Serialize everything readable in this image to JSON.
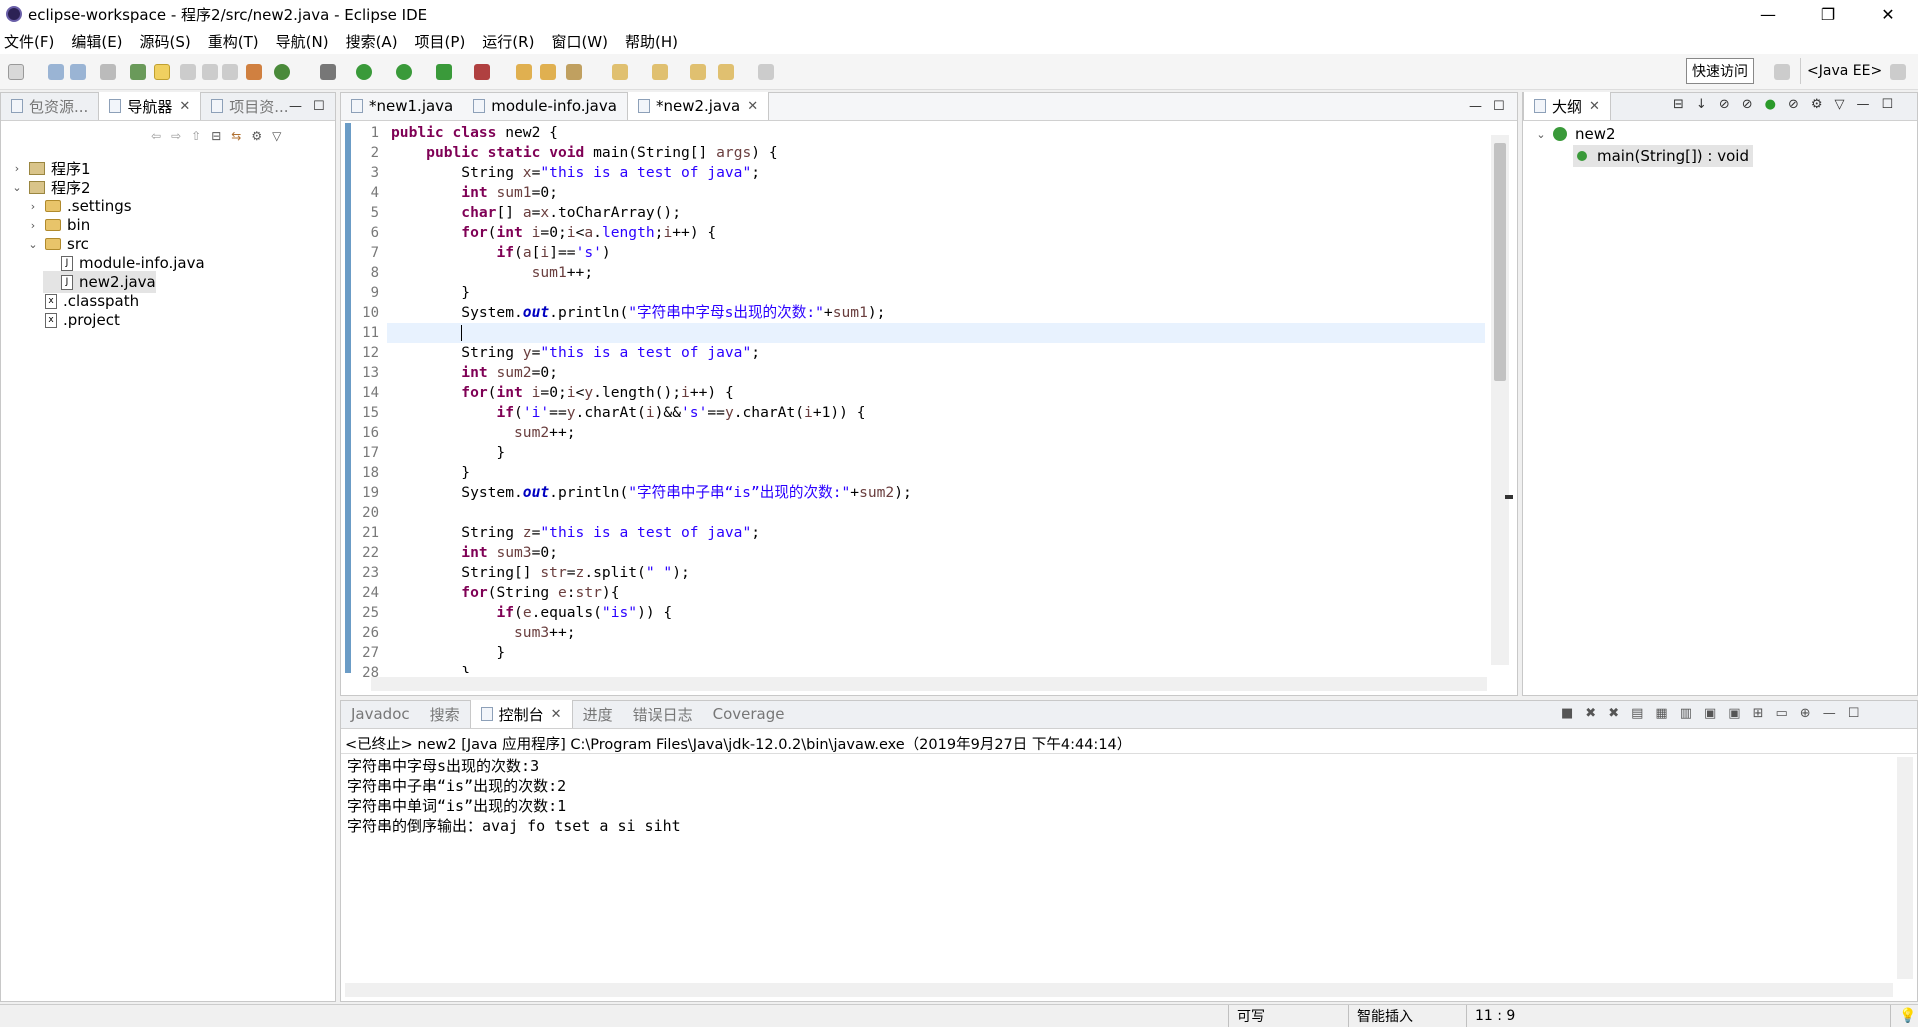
{
  "window": {
    "title": "eclipse-workspace - 程序2/src/new2.java - Eclipse IDE",
    "minimize": "—",
    "restore": "❐",
    "close": "✕"
  },
  "menu": [
    "文件(F)",
    "编辑(E)",
    "源码(S)",
    "重构(T)",
    "导航(N)",
    "搜索(A)",
    "项目(P)",
    "运行(R)",
    "窗口(W)",
    "帮助(H)"
  ],
  "toolbar": {
    "quick_access": "快速访问",
    "perspective": "<Java EE>"
  },
  "left_panel": {
    "tabs": [
      "包资源...",
      "导航器",
      "项目资..."
    ],
    "active_tab": 1,
    "tree": [
      {
        "label": "程序1",
        "type": "project",
        "level": 0,
        "arrow": "›"
      },
      {
        "label": "程序2",
        "type": "project",
        "level": 0,
        "arrow": "⌄"
      },
      {
        "label": ".settings",
        "type": "folder",
        "level": 1,
        "arrow": "›"
      },
      {
        "label": "bin",
        "type": "folder",
        "level": 1,
        "arrow": "›"
      },
      {
        "label": "src",
        "type": "folder",
        "level": 1,
        "arrow": "⌄"
      },
      {
        "label": "module-info.java",
        "type": "file",
        "level": 2,
        "arrow": ""
      },
      {
        "label": "new2.java",
        "type": "file",
        "level": 2,
        "arrow": "",
        "selected": true
      },
      {
        "label": ".classpath",
        "type": "xfile",
        "level": 1,
        "arrow": ""
      },
      {
        "label": ".project",
        "type": "xfile",
        "level": 1,
        "arrow": ""
      }
    ]
  },
  "editor": {
    "tabs": [
      "*new1.java",
      "module-info.java",
      "*new2.java"
    ],
    "active_tab": 2,
    "current_line": 11,
    "lines": [
      [
        [
          "kw",
          "public "
        ],
        [
          "kw",
          "class "
        ],
        [
          "t",
          "new2 {"
        ]
      ],
      [
        [
          "t",
          "    "
        ],
        [
          "kw",
          "public "
        ],
        [
          "kw",
          "static "
        ],
        [
          "kw",
          "void "
        ],
        [
          "t",
          "main(String[] "
        ],
        [
          "var",
          "args"
        ],
        [
          "t",
          ") {"
        ]
      ],
      [
        [
          "t",
          "        String "
        ],
        [
          "var",
          "x"
        ],
        [
          "t",
          "="
        ],
        [
          "str",
          "\"this is a test of java\""
        ],
        [
          "t",
          ";"
        ]
      ],
      [
        [
          "t",
          "        "
        ],
        [
          "kw",
          "int "
        ],
        [
          "var",
          "sum1"
        ],
        [
          "t",
          "=0;"
        ]
      ],
      [
        [
          "t",
          "        "
        ],
        [
          "kw",
          "char"
        ],
        [
          "t",
          "[] "
        ],
        [
          "var",
          "a"
        ],
        [
          "t",
          "="
        ],
        [
          "var",
          "x"
        ],
        [
          "t",
          ".toCharArray();"
        ]
      ],
      [
        [
          "t",
          "        "
        ],
        [
          "kw",
          "for"
        ],
        [
          "t",
          "("
        ],
        [
          "kw",
          "int "
        ],
        [
          "var",
          "i"
        ],
        [
          "t",
          "=0;"
        ],
        [
          "var",
          "i"
        ],
        [
          "t",
          "<"
        ],
        [
          "var",
          "a"
        ],
        [
          "t",
          "."
        ],
        [
          "str",
          "length"
        ],
        [
          "t",
          ";"
        ],
        [
          "var",
          "i"
        ],
        [
          "t",
          "++) {"
        ]
      ],
      [
        [
          "t",
          "            "
        ],
        [
          "kw",
          "if"
        ],
        [
          "t",
          "("
        ],
        [
          "var",
          "a"
        ],
        [
          "t",
          "["
        ],
        [
          "var",
          "i"
        ],
        [
          "t",
          "]=="
        ],
        [
          "str",
          "'s'"
        ],
        [
          "t",
          ")"
        ]
      ],
      [
        [
          "t",
          "                "
        ],
        [
          "var",
          "sum1"
        ],
        [
          "t",
          "++;"
        ]
      ],
      [
        [
          "t",
          "        }"
        ]
      ],
      [
        [
          "t",
          "        System."
        ],
        [
          "fld",
          "out"
        ],
        [
          "t",
          ".println("
        ],
        [
          "str",
          "\"字符串中字母s出现的次数:\""
        ],
        [
          "t",
          "+"
        ],
        [
          "var",
          "sum1"
        ],
        [
          "t",
          ");"
        ]
      ],
      [
        [
          "t",
          "        "
        ]
      ],
      [
        [
          "t",
          "        String "
        ],
        [
          "var",
          "y"
        ],
        [
          "t",
          "="
        ],
        [
          "str",
          "\"this is a test of java\""
        ],
        [
          "t",
          ";"
        ]
      ],
      [
        [
          "t",
          "        "
        ],
        [
          "kw",
          "int "
        ],
        [
          "var",
          "sum2"
        ],
        [
          "t",
          "=0;"
        ]
      ],
      [
        [
          "t",
          "        "
        ],
        [
          "kw",
          "for"
        ],
        [
          "t",
          "("
        ],
        [
          "kw",
          "int "
        ],
        [
          "var",
          "i"
        ],
        [
          "t",
          "=0;"
        ],
        [
          "var",
          "i"
        ],
        [
          "t",
          "<"
        ],
        [
          "var",
          "y"
        ],
        [
          "t",
          ".length();"
        ],
        [
          "var",
          "i"
        ],
        [
          "t",
          "++) {"
        ]
      ],
      [
        [
          "t",
          "            "
        ],
        [
          "kw",
          "if"
        ],
        [
          "t",
          "("
        ],
        [
          "str",
          "'i'"
        ],
        [
          "t",
          "=="
        ],
        [
          "var",
          "y"
        ],
        [
          "t",
          ".charAt("
        ],
        [
          "var",
          "i"
        ],
        [
          "t",
          ")&&"
        ],
        [
          "str",
          "'s'"
        ],
        [
          "t",
          "=="
        ],
        [
          "var",
          "y"
        ],
        [
          "t",
          ".charAt("
        ],
        [
          "var",
          "i"
        ],
        [
          "t",
          "+1)) {"
        ]
      ],
      [
        [
          "t",
          "              "
        ],
        [
          "var",
          "sum2"
        ],
        [
          "t",
          "++;"
        ]
      ],
      [
        [
          "t",
          "            }"
        ]
      ],
      [
        [
          "t",
          "        }"
        ]
      ],
      [
        [
          "t",
          "        System."
        ],
        [
          "fld",
          "out"
        ],
        [
          "t",
          ".println("
        ],
        [
          "str",
          "\"字符串中子串“is”出现的次数:\""
        ],
        [
          "t",
          "+"
        ],
        [
          "var",
          "sum2"
        ],
        [
          "t",
          ");"
        ]
      ],
      [
        [
          "t",
          ""
        ]
      ],
      [
        [
          "t",
          "        String "
        ],
        [
          "var",
          "z"
        ],
        [
          "t",
          "="
        ],
        [
          "str",
          "\"this is a test of java\""
        ],
        [
          "t",
          ";"
        ]
      ],
      [
        [
          "t",
          "        "
        ],
        [
          "kw",
          "int "
        ],
        [
          "var",
          "sum3"
        ],
        [
          "t",
          "=0;"
        ]
      ],
      [
        [
          "t",
          "        String[] "
        ],
        [
          "var",
          "str"
        ],
        [
          "t",
          "="
        ],
        [
          "var",
          "z"
        ],
        [
          "t",
          ".split("
        ],
        [
          "str",
          "\" \""
        ],
        [
          "t",
          ");"
        ]
      ],
      [
        [
          "t",
          "        "
        ],
        [
          "kw",
          "for"
        ],
        [
          "t",
          "(String "
        ],
        [
          "var",
          "e"
        ],
        [
          "t",
          ":"
        ],
        [
          "var",
          "str"
        ],
        [
          "t",
          "){"
        ]
      ],
      [
        [
          "t",
          "            "
        ],
        [
          "kw",
          "if"
        ],
        [
          "t",
          "("
        ],
        [
          "var",
          "e"
        ],
        [
          "t",
          ".equals("
        ],
        [
          "str",
          "\"is\""
        ],
        [
          "t",
          ")) {"
        ]
      ],
      [
        [
          "t",
          "              "
        ],
        [
          "var",
          "sum3"
        ],
        [
          "t",
          "++;"
        ]
      ],
      [
        [
          "t",
          "            }"
        ]
      ],
      [
        [
          "t",
          "        }"
        ]
      ]
    ]
  },
  "outline": {
    "tab": "大纲",
    "class_name": "new2",
    "method": "main(String[]) : void"
  },
  "bottom_panel": {
    "tabs": [
      "Javadoc",
      "搜索",
      "控制台",
      "进度",
      "错误日志",
      "Coverage"
    ],
    "active_tab": 2,
    "header": "<已终止> new2 [Java 应用程序] C:\\Program Files\\Java\\jdk-12.0.2\\bin\\javaw.exe（2019年9月27日 下午4:44:14）",
    "output": [
      "字符串中字母s出现的次数:3",
      "字符串中子串“is”出现的次数:2",
      "字符串中单词“is”出现的次数:1",
      "字符串的倒序输出：avaj fo tset a si siht"
    ]
  },
  "status": {
    "writable": "可写",
    "insert_mode": "智能插入",
    "position": "11 : 9"
  },
  "colors": {
    "keyword": "#7f0055",
    "string": "#2a00ff",
    "current_line": "#e8f2fe",
    "annotation_bar": "#6b9cc6"
  }
}
